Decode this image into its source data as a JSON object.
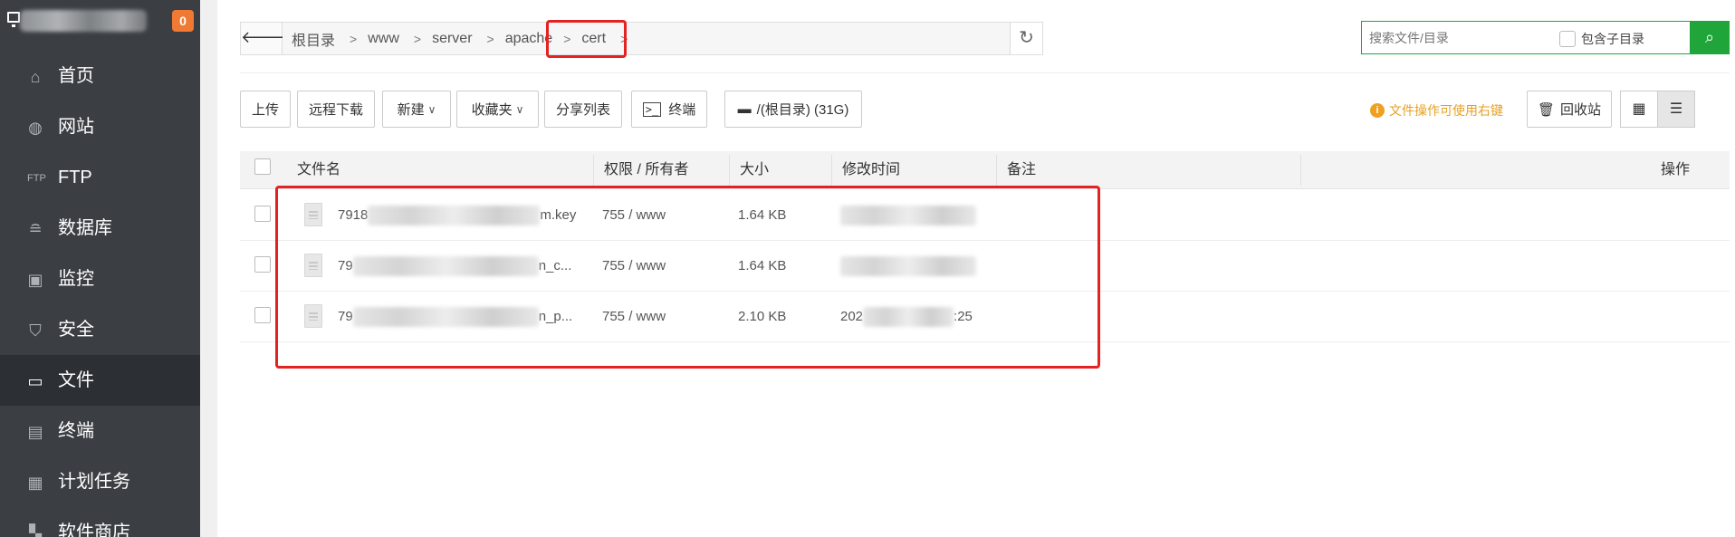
{
  "sidebar": {
    "badge": "0",
    "items": [
      {
        "label": "首页",
        "icon": "home-icon"
      },
      {
        "label": "网站",
        "icon": "globe-icon"
      },
      {
        "label": "FTP",
        "icon": "ftp-icon"
      },
      {
        "label": "数据库",
        "icon": "database-icon"
      },
      {
        "label": "监控",
        "icon": "monitor-chart-icon"
      },
      {
        "label": "安全",
        "icon": "shield-icon"
      },
      {
        "label": "文件",
        "icon": "folder-icon"
      },
      {
        "label": "终端",
        "icon": "terminal-icon"
      },
      {
        "label": "计划任务",
        "icon": "calendar-icon"
      },
      {
        "label": "软件商店",
        "icon": "apps-icon"
      }
    ],
    "active_index": 6
  },
  "breadcrumb": {
    "segments": [
      "根目录",
      "www",
      "server",
      "apache",
      "cert"
    ]
  },
  "search": {
    "placeholder": "搜索文件/目录",
    "subdir_label": "包含子目录"
  },
  "toolbar": {
    "upload": "上传",
    "remote_download": "远程下载",
    "new": "新建",
    "favorites": "收藏夹",
    "share_list": "分享列表",
    "terminal": "终端",
    "disk": "/(根目录) (31G)",
    "tip": "文件操作可使用右键",
    "recycle": "回收站"
  },
  "table": {
    "columns": {
      "name": "文件名",
      "perm": "权限 / 所有者",
      "size": "大小",
      "mtime": "修改时间",
      "note": "备注",
      "ops": "操作"
    },
    "rows": [
      {
        "name_prefix": "7918",
        "name_suffix": "m.key",
        "perm": "755 / www",
        "size": "1.64 KB",
        "mtime_prefix": "",
        "mtime_suffix": ""
      },
      {
        "name_prefix": "79",
        "name_suffix": "n_c...",
        "perm": "755 / www",
        "size": "1.64 KB",
        "mtime_prefix": "",
        "mtime_suffix": ""
      },
      {
        "name_prefix": "79",
        "name_suffix": "n_p...",
        "perm": "755 / www",
        "size": "2.10 KB",
        "mtime_prefix": "202",
        "mtime_suffix": ":25"
      }
    ]
  },
  "colors": {
    "sidebar_bg": "#3b3f44",
    "accent_green": "#20a53a",
    "highlight_red": "#e32222",
    "tip_orange": "#e8a022"
  }
}
